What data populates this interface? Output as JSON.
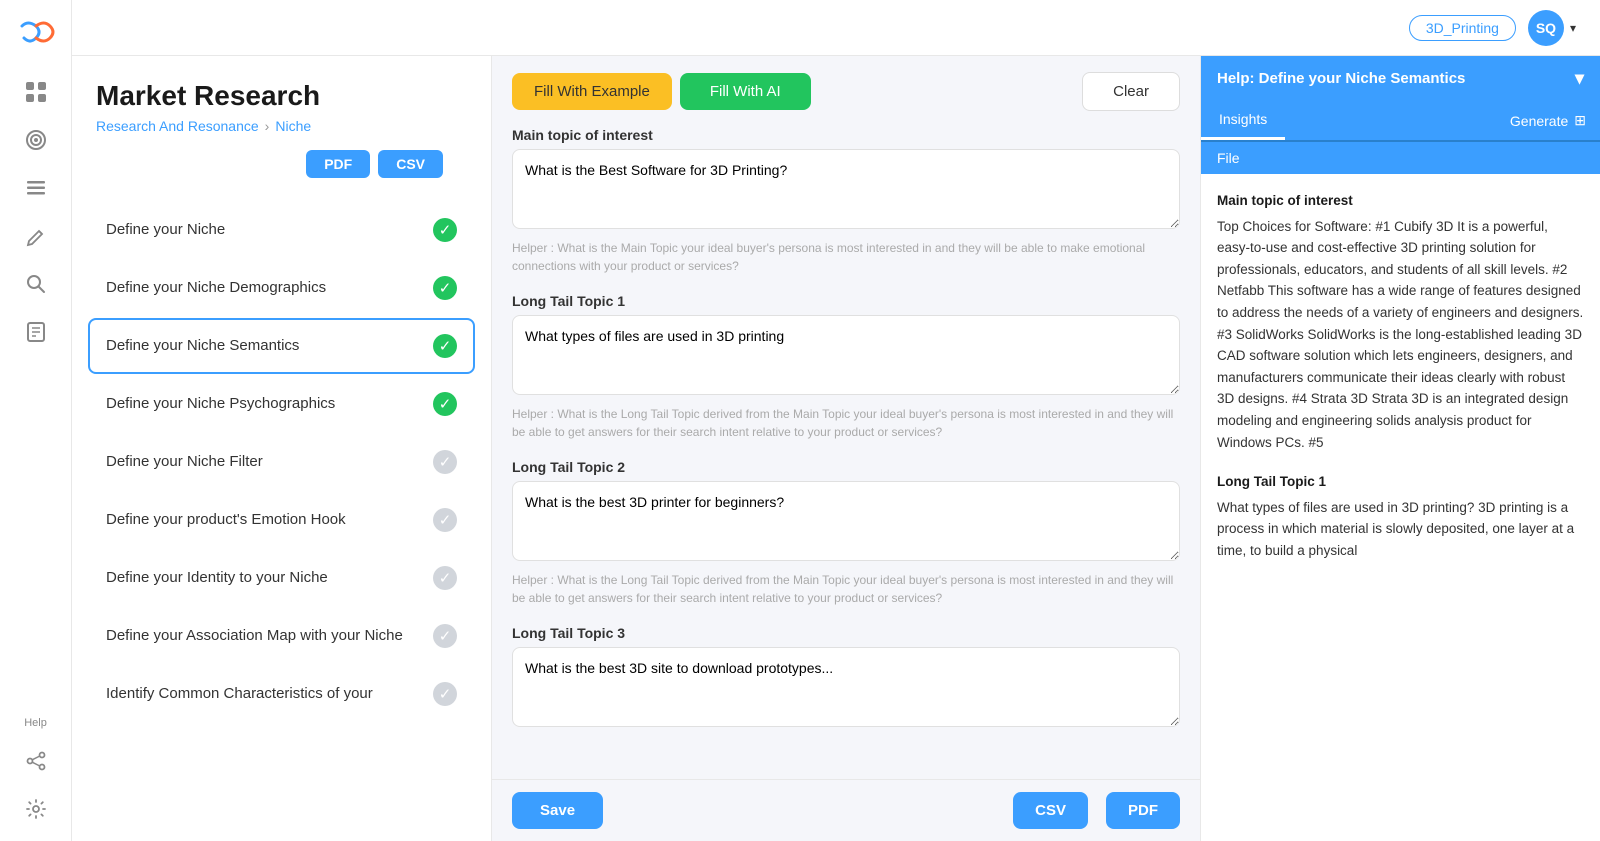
{
  "topbar": {
    "niche_badge": "3D_Printing",
    "avatar_initials": "SQ",
    "chevron": "▾"
  },
  "page": {
    "title": "Market Research",
    "breadcrumb_root": "Research And Resonance",
    "breadcrumb_sep": "›",
    "breadcrumb_current": "Niche",
    "pdf_label": "PDF",
    "csv_label": "CSV"
  },
  "nav_items": [
    {
      "id": "define-niche",
      "label": "Define your Niche",
      "status": "green",
      "active": false
    },
    {
      "id": "define-niche-demographics",
      "label": "Define your Niche Demographics",
      "status": "green",
      "active": false
    },
    {
      "id": "define-niche-semantics",
      "label": "Define your Niche Semantics",
      "status": "green",
      "active": true
    },
    {
      "id": "define-niche-psychographics",
      "label": "Define your Niche Psychographics",
      "status": "green",
      "active": false
    },
    {
      "id": "define-niche-filter",
      "label": "Define your Niche Filter",
      "status": "gray",
      "active": false
    },
    {
      "id": "define-emotion-hook",
      "label": "Define your product's Emotion Hook",
      "status": "gray",
      "active": false
    },
    {
      "id": "define-identity",
      "label": "Define your Identity to your Niche",
      "status": "gray",
      "active": false
    },
    {
      "id": "define-association-map",
      "label": "Define your Association Map with your Niche",
      "status": "gray",
      "active": false
    },
    {
      "id": "identify-common",
      "label": "Identify Common Characteristics of your",
      "status": "gray",
      "active": false
    }
  ],
  "toolbar": {
    "fill_example_label": "Fill With Example",
    "fill_ai_label": "Fill With AI",
    "clear_label": "Clear"
  },
  "form": {
    "main_topic_label": "Main topic of interest",
    "main_topic_value": "What is the Best Software for 3D Printing?",
    "main_topic_helper": "Helper : What is the Main Topic your ideal buyer's persona is most interested in and they will be able to make emotional connections with your product or services?",
    "long_tail_1_label": "Long Tail Topic 1",
    "long_tail_1_value": "What types of files are used in 3D printing",
    "long_tail_1_helper": "Helper : What is the Long Tail Topic derived from the Main Topic your ideal buyer's persona is most interested in and they will be able to get answers for their search intent relative to your product or services?",
    "long_tail_2_label": "Long Tail Topic 2",
    "long_tail_2_value": "What is the best 3D printer for beginners?",
    "long_tail_2_helper": "Helper : What is the Long Tail Topic derived from the Main Topic your ideal buyer's persona is most interested in and they will be able to get answers for their search intent relative to your product or services?",
    "long_tail_3_label": "Long Tail Topic 3",
    "long_tail_3_value": "What is the best 3D site to download prototypes..."
  },
  "footer": {
    "save_label": "Save",
    "csv_label": "CSV",
    "pdf_label": "PDF"
  },
  "right_panel": {
    "header_label": "Help: Define your Niche Semantics",
    "chevron": "▾",
    "tab_insights": "Insights",
    "tab_generate": "Generate",
    "generate_icon": "⊞",
    "tab_file": "File",
    "insight_main_label": "Main topic of interest",
    "insight_main_text": "Top Choices for Software: #1 Cubify 3D It is a powerful, easy-to-use and cost-effective 3D printing solution for professionals, educators, and students of all skill levels. #2 Netfabb This software has a wide range of features designed to address the needs of a variety of engineers and designers. #3 SolidWorks SolidWorks is the long-established leading 3D CAD software solution which lets engineers, designers, and manufacturers communicate their ideas clearly with robust 3D designs. #4 Strata 3D Strata 3D is an integrated design modeling and engineering solids analysis product for Windows PCs. #5",
    "insight_longtail_label": "Long Tail Topic 1",
    "insight_longtail_text": "What types of files are used in 3D printing? 3D printing is a process in which material is slowly deposited, one layer at a time, to build a physical"
  },
  "sidebar_icons": [
    {
      "id": "dashboard",
      "icon": "⊞"
    },
    {
      "id": "target",
      "icon": "◎"
    },
    {
      "id": "list",
      "icon": "≡"
    },
    {
      "id": "edit",
      "icon": "✎"
    },
    {
      "id": "search",
      "icon": "⌕"
    },
    {
      "id": "notes",
      "icon": "📋"
    },
    {
      "id": "help",
      "label": "Help"
    },
    {
      "id": "share",
      "icon": "⇧"
    },
    {
      "id": "settings",
      "icon": "⚙"
    }
  ]
}
